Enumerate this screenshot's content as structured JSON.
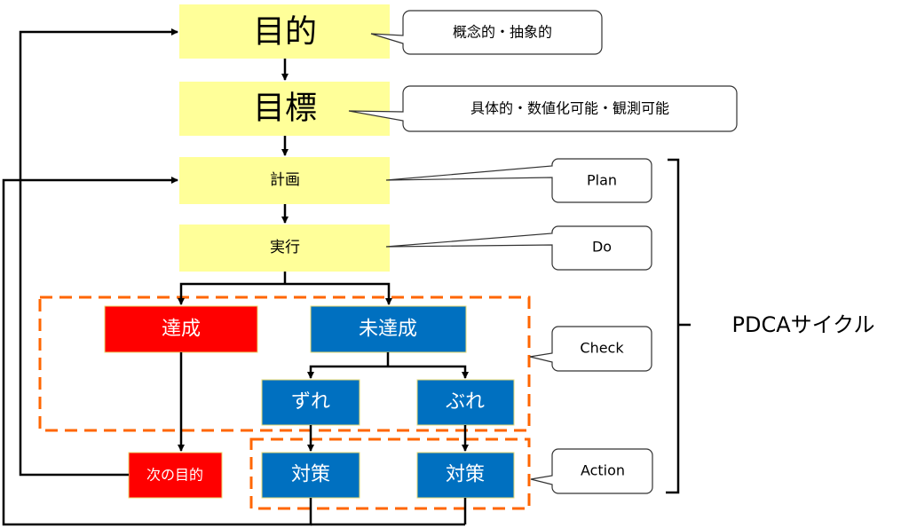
{
  "colors": {
    "yellow_box": "#FFFF99",
    "achieved_red": "#FF0000",
    "unachieved_blue": "#0070C0",
    "dashed_orange": "#FF6600",
    "line": "#000000",
    "white_text": "#FFFFFF"
  },
  "nodes": {
    "purpose": "目的",
    "goal": "目標",
    "plan": "計画",
    "execution": "実行",
    "achieved": "達成",
    "not_achieved": "未達成",
    "deviation": "ずれ",
    "variance": "ぶれ",
    "next_purpose": "次の目的",
    "countermeasure_1": "対策",
    "countermeasure_2": "対策"
  },
  "callouts": {
    "purpose": "概念的・抽象的",
    "goal": "具体的・数値化可能・観測可能",
    "plan": "Plan",
    "do": "Do",
    "check": "Check",
    "action": "Action"
  },
  "bracket_label": "PDCAサイクル"
}
